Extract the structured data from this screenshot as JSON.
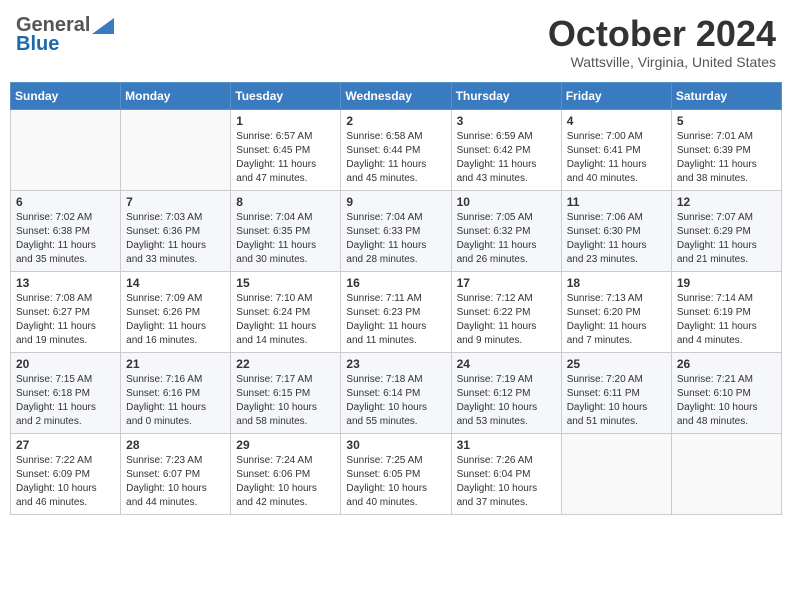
{
  "header": {
    "logo_general": "General",
    "logo_blue": "Blue",
    "month": "October 2024",
    "location": "Wattsville, Virginia, United States"
  },
  "weekdays": [
    "Sunday",
    "Monday",
    "Tuesday",
    "Wednesday",
    "Thursday",
    "Friday",
    "Saturday"
  ],
  "weeks": [
    [
      {
        "day": "",
        "sunrise": "",
        "sunset": "",
        "daylight": ""
      },
      {
        "day": "",
        "sunrise": "",
        "sunset": "",
        "daylight": ""
      },
      {
        "day": "1",
        "sunrise": "Sunrise: 6:57 AM",
        "sunset": "Sunset: 6:45 PM",
        "daylight": "Daylight: 11 hours and 47 minutes."
      },
      {
        "day": "2",
        "sunrise": "Sunrise: 6:58 AM",
        "sunset": "Sunset: 6:44 PM",
        "daylight": "Daylight: 11 hours and 45 minutes."
      },
      {
        "day": "3",
        "sunrise": "Sunrise: 6:59 AM",
        "sunset": "Sunset: 6:42 PM",
        "daylight": "Daylight: 11 hours and 43 minutes."
      },
      {
        "day": "4",
        "sunrise": "Sunrise: 7:00 AM",
        "sunset": "Sunset: 6:41 PM",
        "daylight": "Daylight: 11 hours and 40 minutes."
      },
      {
        "day": "5",
        "sunrise": "Sunrise: 7:01 AM",
        "sunset": "Sunset: 6:39 PM",
        "daylight": "Daylight: 11 hours and 38 minutes."
      }
    ],
    [
      {
        "day": "6",
        "sunrise": "Sunrise: 7:02 AM",
        "sunset": "Sunset: 6:38 PM",
        "daylight": "Daylight: 11 hours and 35 minutes."
      },
      {
        "day": "7",
        "sunrise": "Sunrise: 7:03 AM",
        "sunset": "Sunset: 6:36 PM",
        "daylight": "Daylight: 11 hours and 33 minutes."
      },
      {
        "day": "8",
        "sunrise": "Sunrise: 7:04 AM",
        "sunset": "Sunset: 6:35 PM",
        "daylight": "Daylight: 11 hours and 30 minutes."
      },
      {
        "day": "9",
        "sunrise": "Sunrise: 7:04 AM",
        "sunset": "Sunset: 6:33 PM",
        "daylight": "Daylight: 11 hours and 28 minutes."
      },
      {
        "day": "10",
        "sunrise": "Sunrise: 7:05 AM",
        "sunset": "Sunset: 6:32 PM",
        "daylight": "Daylight: 11 hours and 26 minutes."
      },
      {
        "day": "11",
        "sunrise": "Sunrise: 7:06 AM",
        "sunset": "Sunset: 6:30 PM",
        "daylight": "Daylight: 11 hours and 23 minutes."
      },
      {
        "day": "12",
        "sunrise": "Sunrise: 7:07 AM",
        "sunset": "Sunset: 6:29 PM",
        "daylight": "Daylight: 11 hours and 21 minutes."
      }
    ],
    [
      {
        "day": "13",
        "sunrise": "Sunrise: 7:08 AM",
        "sunset": "Sunset: 6:27 PM",
        "daylight": "Daylight: 11 hours and 19 minutes."
      },
      {
        "day": "14",
        "sunrise": "Sunrise: 7:09 AM",
        "sunset": "Sunset: 6:26 PM",
        "daylight": "Daylight: 11 hours and 16 minutes."
      },
      {
        "day": "15",
        "sunrise": "Sunrise: 7:10 AM",
        "sunset": "Sunset: 6:24 PM",
        "daylight": "Daylight: 11 hours and 14 minutes."
      },
      {
        "day": "16",
        "sunrise": "Sunrise: 7:11 AM",
        "sunset": "Sunset: 6:23 PM",
        "daylight": "Daylight: 11 hours and 11 minutes."
      },
      {
        "day": "17",
        "sunrise": "Sunrise: 7:12 AM",
        "sunset": "Sunset: 6:22 PM",
        "daylight": "Daylight: 11 hours and 9 minutes."
      },
      {
        "day": "18",
        "sunrise": "Sunrise: 7:13 AM",
        "sunset": "Sunset: 6:20 PM",
        "daylight": "Daylight: 11 hours and 7 minutes."
      },
      {
        "day": "19",
        "sunrise": "Sunrise: 7:14 AM",
        "sunset": "Sunset: 6:19 PM",
        "daylight": "Daylight: 11 hours and 4 minutes."
      }
    ],
    [
      {
        "day": "20",
        "sunrise": "Sunrise: 7:15 AM",
        "sunset": "Sunset: 6:18 PM",
        "daylight": "Daylight: 11 hours and 2 minutes."
      },
      {
        "day": "21",
        "sunrise": "Sunrise: 7:16 AM",
        "sunset": "Sunset: 6:16 PM",
        "daylight": "Daylight: 11 hours and 0 minutes."
      },
      {
        "day": "22",
        "sunrise": "Sunrise: 7:17 AM",
        "sunset": "Sunset: 6:15 PM",
        "daylight": "Daylight: 10 hours and 58 minutes."
      },
      {
        "day": "23",
        "sunrise": "Sunrise: 7:18 AM",
        "sunset": "Sunset: 6:14 PM",
        "daylight": "Daylight: 10 hours and 55 minutes."
      },
      {
        "day": "24",
        "sunrise": "Sunrise: 7:19 AM",
        "sunset": "Sunset: 6:12 PM",
        "daylight": "Daylight: 10 hours and 53 minutes."
      },
      {
        "day": "25",
        "sunrise": "Sunrise: 7:20 AM",
        "sunset": "Sunset: 6:11 PM",
        "daylight": "Daylight: 10 hours and 51 minutes."
      },
      {
        "day": "26",
        "sunrise": "Sunrise: 7:21 AM",
        "sunset": "Sunset: 6:10 PM",
        "daylight": "Daylight: 10 hours and 48 minutes."
      }
    ],
    [
      {
        "day": "27",
        "sunrise": "Sunrise: 7:22 AM",
        "sunset": "Sunset: 6:09 PM",
        "daylight": "Daylight: 10 hours and 46 minutes."
      },
      {
        "day": "28",
        "sunrise": "Sunrise: 7:23 AM",
        "sunset": "Sunset: 6:07 PM",
        "daylight": "Daylight: 10 hours and 44 minutes."
      },
      {
        "day": "29",
        "sunrise": "Sunrise: 7:24 AM",
        "sunset": "Sunset: 6:06 PM",
        "daylight": "Daylight: 10 hours and 42 minutes."
      },
      {
        "day": "30",
        "sunrise": "Sunrise: 7:25 AM",
        "sunset": "Sunset: 6:05 PM",
        "daylight": "Daylight: 10 hours and 40 minutes."
      },
      {
        "day": "31",
        "sunrise": "Sunrise: 7:26 AM",
        "sunset": "Sunset: 6:04 PM",
        "daylight": "Daylight: 10 hours and 37 minutes."
      },
      {
        "day": "",
        "sunrise": "",
        "sunset": "",
        "daylight": ""
      },
      {
        "day": "",
        "sunrise": "",
        "sunset": "",
        "daylight": ""
      }
    ]
  ]
}
